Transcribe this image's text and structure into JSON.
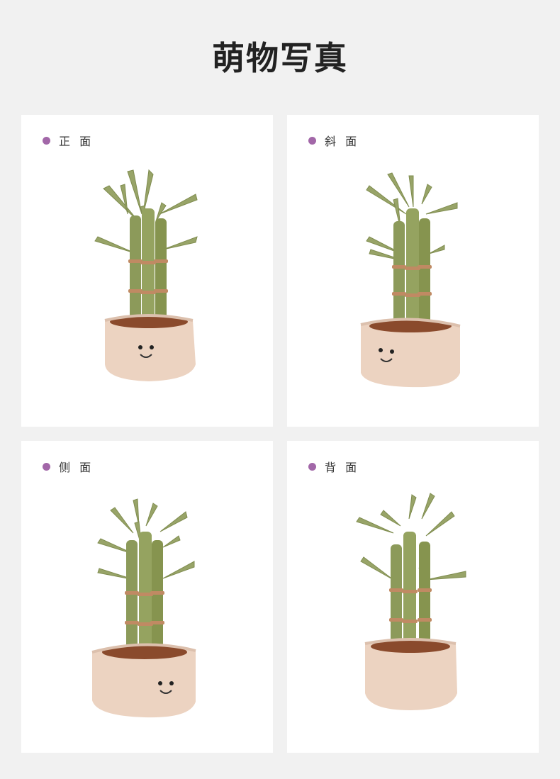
{
  "page": {
    "title": "萌物写真"
  },
  "colors": {
    "background": "#f1f1f1",
    "card": "#ffffff",
    "dot": "#a267a8",
    "stalk": "#8c9a5a",
    "leaf": "#98a468",
    "ring": "#c08a63",
    "pot": "#ecd3c1",
    "soil": "#8a4a2c"
  },
  "cards": [
    {
      "label": "正 面"
    },
    {
      "label": "斜 面"
    },
    {
      "label": "侧 面"
    },
    {
      "label": "背 面"
    }
  ]
}
